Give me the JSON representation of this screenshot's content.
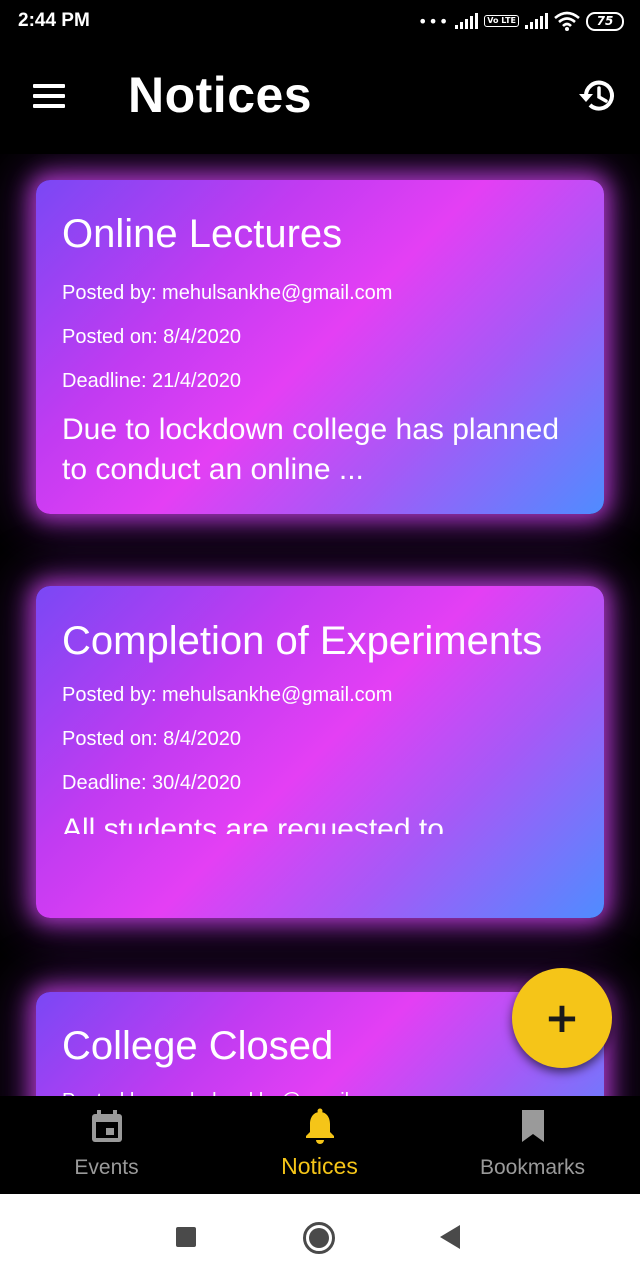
{
  "status_bar": {
    "time": "2:44 PM",
    "dots": "•••",
    "volte": "Vo LTE",
    "battery": "75"
  },
  "app_bar": {
    "title": "Notices",
    "menu_icon": "hamburger-menu-icon",
    "history_icon": "history-icon"
  },
  "notices": [
    {
      "title": "Online Lectures",
      "posted_by": "Posted by: mehulsankhe@gmail.com",
      "posted_on": "Posted on: 8/4/2020",
      "deadline": "Deadline: 21/4/2020",
      "description": "Due to lockdown college has planned to conduct an online ..."
    },
    {
      "title": "Completion of Experiments",
      "posted_by": "Posted by: mehulsankhe@gmail.com",
      "posted_on": "Posted on: 8/4/2020",
      "deadline": "Deadline: 30/4/2020",
      "description": "All students are requested to"
    },
    {
      "title": "College Closed",
      "posted_by": "Posted by: mehulsankhe@gmail.com"
    }
  ],
  "fab": {
    "label": "+",
    "icon": "add-icon"
  },
  "bottom_nav": {
    "items": [
      {
        "label": "Events",
        "icon": "calendar-icon",
        "active": false
      },
      {
        "label": "Notices",
        "icon": "bell-icon",
        "active": true
      },
      {
        "label": "Bookmarks",
        "icon": "bookmark-icon",
        "active": false
      }
    ]
  },
  "colors": {
    "accent": "#f5c518",
    "background": "#000000",
    "card_gradient_start": "#7a48f4",
    "card_gradient_mid": "#e43ff4",
    "card_gradient_end": "#4f8cff",
    "inactive_nav": "#9a9a9a"
  },
  "system_nav": {
    "recents_icon": "square-recents-icon",
    "home_icon": "circle-home-icon",
    "back_icon": "triangle-back-icon"
  }
}
